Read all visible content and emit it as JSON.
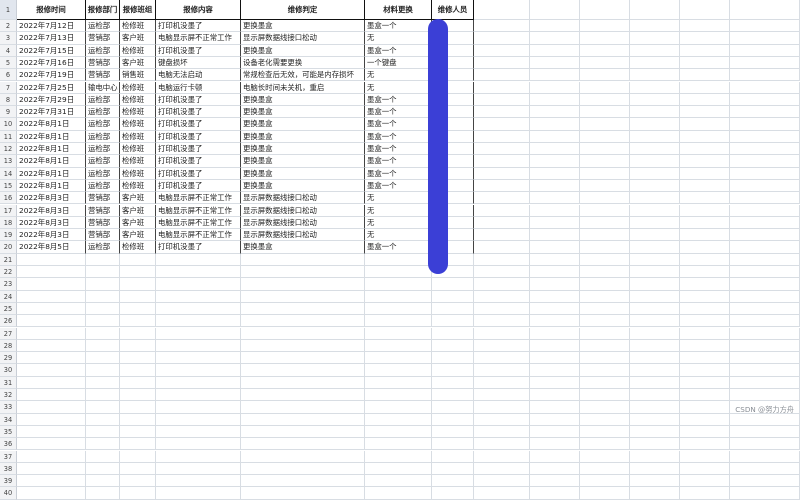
{
  "sheet": {
    "headers": [
      "报修时间",
      "报修部门",
      "报修班组",
      "报修内容",
      "维修判定",
      "材料更换",
      "维修人员"
    ],
    "rows": [
      [
        "2022年7月12日",
        "运检部",
        "检修班",
        "打印机没墨了",
        "更换墨盒",
        "墨盒一个",
        ""
      ],
      [
        "2022年7月13日",
        "营销部",
        "客户班",
        "电脑显示屏不正常工作",
        "显示屏数据线接口松动",
        "无",
        ""
      ],
      [
        "2022年7月15日",
        "运检部",
        "检修班",
        "打印机没墨了",
        "更换墨盒",
        "墨盒一个",
        ""
      ],
      [
        "2022年7月16日",
        "营销部",
        "客户班",
        "键盘损坏",
        "设备老化需要更换",
        "一个键盘",
        ""
      ],
      [
        "2022年7月19日",
        "营销部",
        "销售班",
        "电脑无法启动",
        "常规检查后无效，可能是内存损坏",
        "无",
        ""
      ],
      [
        "2022年7月25日",
        "输电中心",
        "检修班",
        "电脑运行卡顿",
        "电脑长时间未关机，重启",
        "无",
        ""
      ],
      [
        "2022年7月29日",
        "运检部",
        "检修班",
        "打印机没墨了",
        "更换墨盒",
        "墨盒一个",
        ""
      ],
      [
        "2022年7月31日",
        "运检部",
        "检修班",
        "打印机没墨了",
        "更换墨盒",
        "墨盒一个",
        ""
      ],
      [
        "2022年8月1日",
        "运检部",
        "检修班",
        "打印机没墨了",
        "更换墨盒",
        "墨盒一个",
        ""
      ],
      [
        "2022年8月1日",
        "运检部",
        "检修班",
        "打印机没墨了",
        "更换墨盒",
        "墨盒一个",
        ""
      ],
      [
        "2022年8月1日",
        "运检部",
        "检修班",
        "打印机没墨了",
        "更换墨盒",
        "墨盒一个",
        ""
      ],
      [
        "2022年8月1日",
        "运检部",
        "检修班",
        "打印机没墨了",
        "更换墨盒",
        "墨盒一个",
        ""
      ],
      [
        "2022年8月1日",
        "运检部",
        "检修班",
        "打印机没墨了",
        "更换墨盒",
        "墨盒一个",
        ""
      ],
      [
        "2022年8月1日",
        "运检部",
        "检修班",
        "打印机没墨了",
        "更换墨盒",
        "墨盒一个",
        ""
      ],
      [
        "2022年8月3日",
        "营销部",
        "客户班",
        "电脑显示屏不正常工作",
        "显示屏数据线接口松动",
        "无",
        ""
      ],
      [
        "2022年8月3日",
        "营销部",
        "客户班",
        "电脑显示屏不正常工作",
        "显示屏数据线接口松动",
        "无",
        ""
      ],
      [
        "2022年8月3日",
        "营销部",
        "客户班",
        "电脑显示屏不正常工作",
        "显示屏数据线接口松动",
        "无",
        ""
      ],
      [
        "2022年8月3日",
        "营销部",
        "客户班",
        "电脑显示屏不正常工作",
        "显示屏数据线接口松动",
        "无",
        ""
      ],
      [
        "2022年8月5日",
        "运检部",
        "检修班",
        "打印机没墨了",
        "更换墨盒",
        "墨盒一个",
        ""
      ]
    ],
    "row_numbers": [
      "1",
      "2",
      "3",
      "4",
      "5",
      "6",
      "7",
      "8",
      "9",
      "10",
      "11",
      "12",
      "13",
      "14",
      "15",
      "16",
      "17",
      "18",
      "19",
      "20",
      "21",
      "22",
      "23",
      "24",
      "25",
      "26",
      "27",
      "28",
      "29",
      "30",
      "31",
      "32",
      "33",
      "34",
      "35",
      "36",
      "37",
      "38",
      "39",
      "40"
    ],
    "highlight_color": "#3b3fd6"
  },
  "watermark": "CSDN @努力方舟"
}
